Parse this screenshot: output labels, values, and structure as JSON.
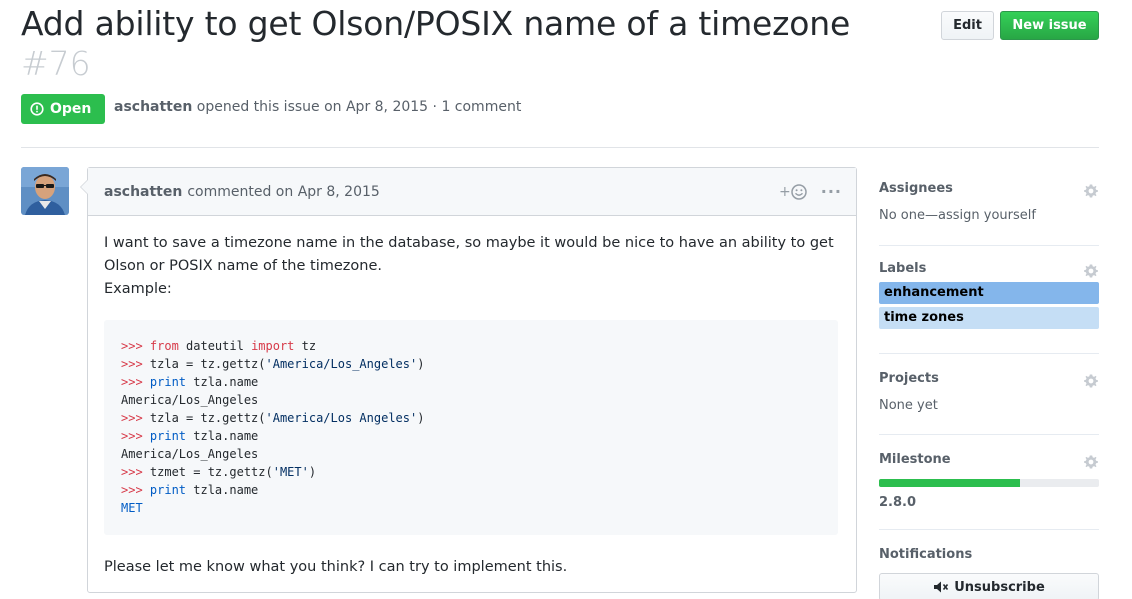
{
  "issue": {
    "title": "Add ability to get Olson/POSIX name of a timezone",
    "number": "#76",
    "state": "Open",
    "author": "aschatten",
    "opened_text": "opened this issue on Apr 8, 2015 · 1 comment"
  },
  "actions": {
    "edit_label": "Edit",
    "new_issue_label": "New issue"
  },
  "comment": {
    "author": "aschatten",
    "meta": "commented on Apr 8, 2015",
    "reaction_plus": "+",
    "more": "···",
    "para1": "I want to save a timezone name in the database, so maybe it would be nice to have an ability to get Olson or POSIX name of the timezone.",
    "para1_line2": "Example:",
    "code_lines": [
      [
        {
          "t": "prompt",
          "v": ">>> "
        },
        {
          "t": "kw",
          "v": "from"
        },
        {
          "t": "plain",
          "v": " dateutil "
        },
        {
          "t": "kw",
          "v": "import"
        },
        {
          "t": "plain",
          "v": " tz"
        }
      ],
      [
        {
          "t": "prompt",
          "v": ">>> "
        },
        {
          "t": "plain",
          "v": "tzla = tz.gettz("
        },
        {
          "t": "str",
          "v": "'America/Los_Angeles'"
        },
        {
          "t": "plain",
          "v": ")"
        }
      ],
      [
        {
          "t": "prompt",
          "v": ">>> "
        },
        {
          "t": "bi",
          "v": "print"
        },
        {
          "t": "plain",
          "v": " tzla.name"
        }
      ],
      [
        {
          "t": "plain",
          "v": "America/Los_Angeles"
        }
      ],
      [
        {
          "t": "prompt",
          "v": ">>> "
        },
        {
          "t": "plain",
          "v": "tzla = tz.gettz("
        },
        {
          "t": "str",
          "v": "'America/Los Angeles'"
        },
        {
          "t": "plain",
          "v": ")"
        }
      ],
      [
        {
          "t": "prompt",
          "v": ">>> "
        },
        {
          "t": "bi",
          "v": "print"
        },
        {
          "t": "plain",
          "v": " tzla.name"
        }
      ],
      [
        {
          "t": "plain",
          "v": "America/Los_Angeles"
        }
      ],
      [
        {
          "t": "prompt",
          "v": ">>> "
        },
        {
          "t": "plain",
          "v": "tzmet = tz.gettz("
        },
        {
          "t": "str",
          "v": "'MET'"
        },
        {
          "t": "plain",
          "v": ")"
        }
      ],
      [
        {
          "t": "prompt",
          "v": ">>> "
        },
        {
          "t": "bi",
          "v": "print"
        },
        {
          "t": "plain",
          "v": " tzla.name"
        }
      ],
      [
        {
          "t": "bi",
          "v": "MET"
        }
      ]
    ],
    "closing": "Please let me know what you think? I can try to implement this."
  },
  "sidebar": {
    "assignees": {
      "heading": "Assignees",
      "text": "No one—assign yourself"
    },
    "labels": {
      "heading": "Labels",
      "items": [
        {
          "name": "enhancement",
          "color": "#84b6eb"
        },
        {
          "name": "time zones",
          "color": "#c5def5"
        }
      ]
    },
    "projects": {
      "heading": "Projects",
      "text": "None yet"
    },
    "milestone": {
      "heading": "Milestone",
      "name": "2.8.0",
      "progress": 0.64
    },
    "notifications": {
      "heading": "Notifications",
      "unsubscribe_label": "Unsubscribe"
    }
  },
  "icons": {
    "state": "issue-opened-icon",
    "gear": "gear-icon",
    "reaction": "smiley-icon",
    "mute": "mute-icon"
  },
  "colors": {
    "open_green": "#2cbe4e",
    "new_issue_green": "#28a745",
    "muted_text": "#586069"
  }
}
